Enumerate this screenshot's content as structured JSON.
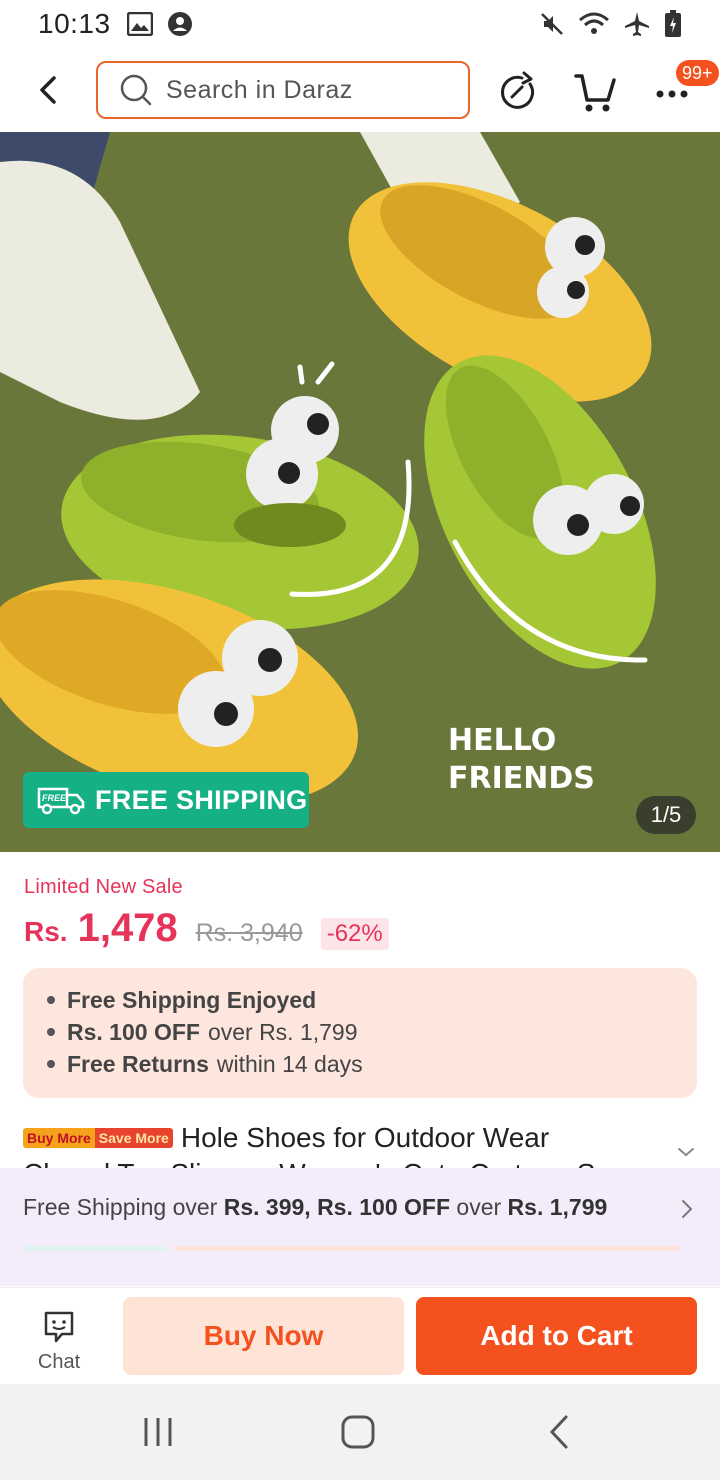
{
  "status_bar": {
    "time": "10:13"
  },
  "header": {
    "search_placeholder": "Search in Daraz",
    "cart_badge": "99+"
  },
  "product_image": {
    "free_shipping_badge_small": "FREE",
    "free_shipping_label": "FREE SHIPPING",
    "image_text_line1": "HELLO",
    "image_text_line2": "FRIENDS",
    "counter": "1/5"
  },
  "price": {
    "sale_label": "Limited New Sale",
    "currency": "Rs.",
    "current": "1,478",
    "original": "Rs. 3,940",
    "discount": "-62%"
  },
  "promo": {
    "line1_bold": "Free Shipping Enjoyed",
    "line2_bold": "Rs. 100 OFF",
    "line2_rest": "over Rs. 1,799",
    "line3_bold": "Free Returns",
    "line3_rest": "within 14 days"
  },
  "title": {
    "tag_buy_more": "Buy More",
    "tag_save_more": "Save More",
    "text_line1": "Hole Shoes for Outdoor Wear",
    "text_line2": "Closed Toe Slippers Women's Cute Cartoon S..."
  },
  "shipping_strip": {
    "text_a": "Free Shipping over",
    "text_b": "Rs. 399, Rs. 100 OFF",
    "text_c": "over",
    "text_d": "Rs. 1,799"
  },
  "actions": {
    "chat_label": "Chat",
    "buy_now": "Buy Now",
    "add_to_cart": "Add to Cart"
  },
  "colors": {
    "accent": "#f5511e",
    "price_red": "#e6335a",
    "free_shipping_green": "#16b087"
  }
}
